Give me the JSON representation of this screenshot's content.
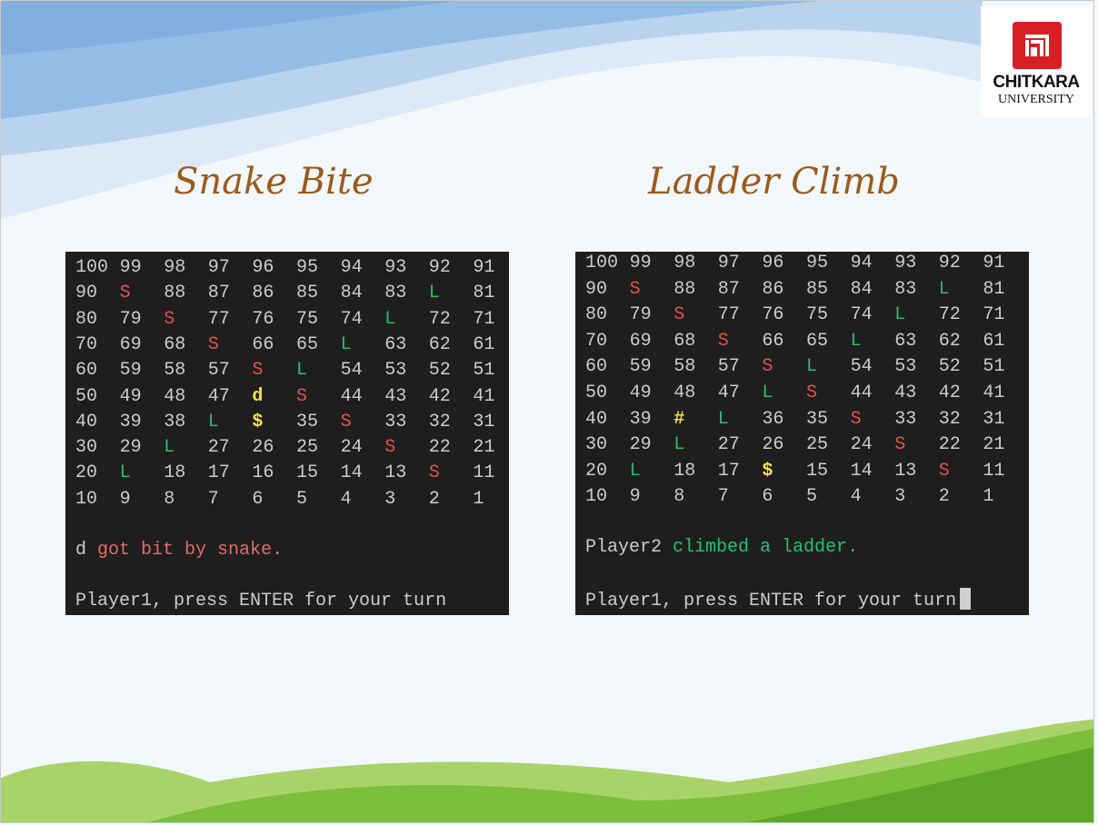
{
  "logo": {
    "name": "CHITKARA",
    "subtitle": "UNIVERSITY",
    "brand_color": "#d71f26"
  },
  "colors": {
    "title": "#9b5a1d",
    "snake": "#e5534b",
    "ladder": "#2dbb6f",
    "player": "#f4e24a",
    "terminal_bg": "#1e1e1e"
  },
  "left": {
    "title": "Snake Bite",
    "grid": [
      [
        "100",
        "99",
        "98",
        "97",
        "96",
        "95",
        "94",
        "93",
        "92",
        "91"
      ],
      [
        "90",
        "S",
        "88",
        "87",
        "86",
        "85",
        "84",
        "83",
        "L",
        "81"
      ],
      [
        "80",
        "79",
        "S",
        "77",
        "76",
        "75",
        "74",
        "L",
        "72",
        "71"
      ],
      [
        "70",
        "69",
        "68",
        "S",
        "66",
        "65",
        "L",
        "63",
        "62",
        "61"
      ],
      [
        "60",
        "59",
        "58",
        "57",
        "S",
        "L",
        "54",
        "53",
        "52",
        "51"
      ],
      [
        "50",
        "49",
        "48",
        "47",
        "d",
        "S",
        "44",
        "43",
        "42",
        "41"
      ],
      [
        "40",
        "39",
        "38",
        "L",
        "$",
        "35",
        "S",
        "33",
        "32",
        "31"
      ],
      [
        "30",
        "29",
        "L",
        "27",
        "26",
        "25",
        "24",
        "S",
        "22",
        "21"
      ],
      [
        "20",
        "L",
        "18",
        "17",
        "16",
        "15",
        "14",
        "13",
        "S",
        "11"
      ],
      [
        "10",
        "9",
        "8",
        "7",
        "6",
        "5",
        "4",
        "3",
        "2",
        "1"
      ]
    ],
    "message_player": "d",
    "message_text": "got bit by snake.",
    "prompt": "Player1, press ENTER for your turn"
  },
  "right": {
    "title": "Ladder Climb",
    "grid": [
      [
        "100",
        "99",
        "98",
        "97",
        "96",
        "95",
        "94",
        "93",
        "92",
        "91"
      ],
      [
        "90",
        "S",
        "88",
        "87",
        "86",
        "85",
        "84",
        "83",
        "L",
        "81"
      ],
      [
        "80",
        "79",
        "S",
        "77",
        "76",
        "75",
        "74",
        "L",
        "72",
        "71"
      ],
      [
        "70",
        "69",
        "68",
        "S",
        "66",
        "65",
        "L",
        "63",
        "62",
        "61"
      ],
      [
        "60",
        "59",
        "58",
        "57",
        "S",
        "L",
        "54",
        "53",
        "52",
        "51"
      ],
      [
        "50",
        "49",
        "48",
        "47",
        "L",
        "S",
        "44",
        "43",
        "42",
        "41"
      ],
      [
        "40",
        "39",
        "#",
        "L",
        "36",
        "35",
        "S",
        "33",
        "32",
        "31"
      ],
      [
        "30",
        "29",
        "L",
        "27",
        "26",
        "25",
        "24",
        "S",
        "22",
        "21"
      ],
      [
        "20",
        "L",
        "18",
        "17",
        "$",
        "15",
        "14",
        "13",
        "S",
        "11"
      ],
      [
        "10",
        "9",
        "8",
        "7",
        "6",
        "5",
        "4",
        "3",
        "2",
        "1"
      ]
    ],
    "message_player": "Player2",
    "message_text": "climbed a ladder.",
    "prompt": "Player1, press ENTER for your turn"
  }
}
